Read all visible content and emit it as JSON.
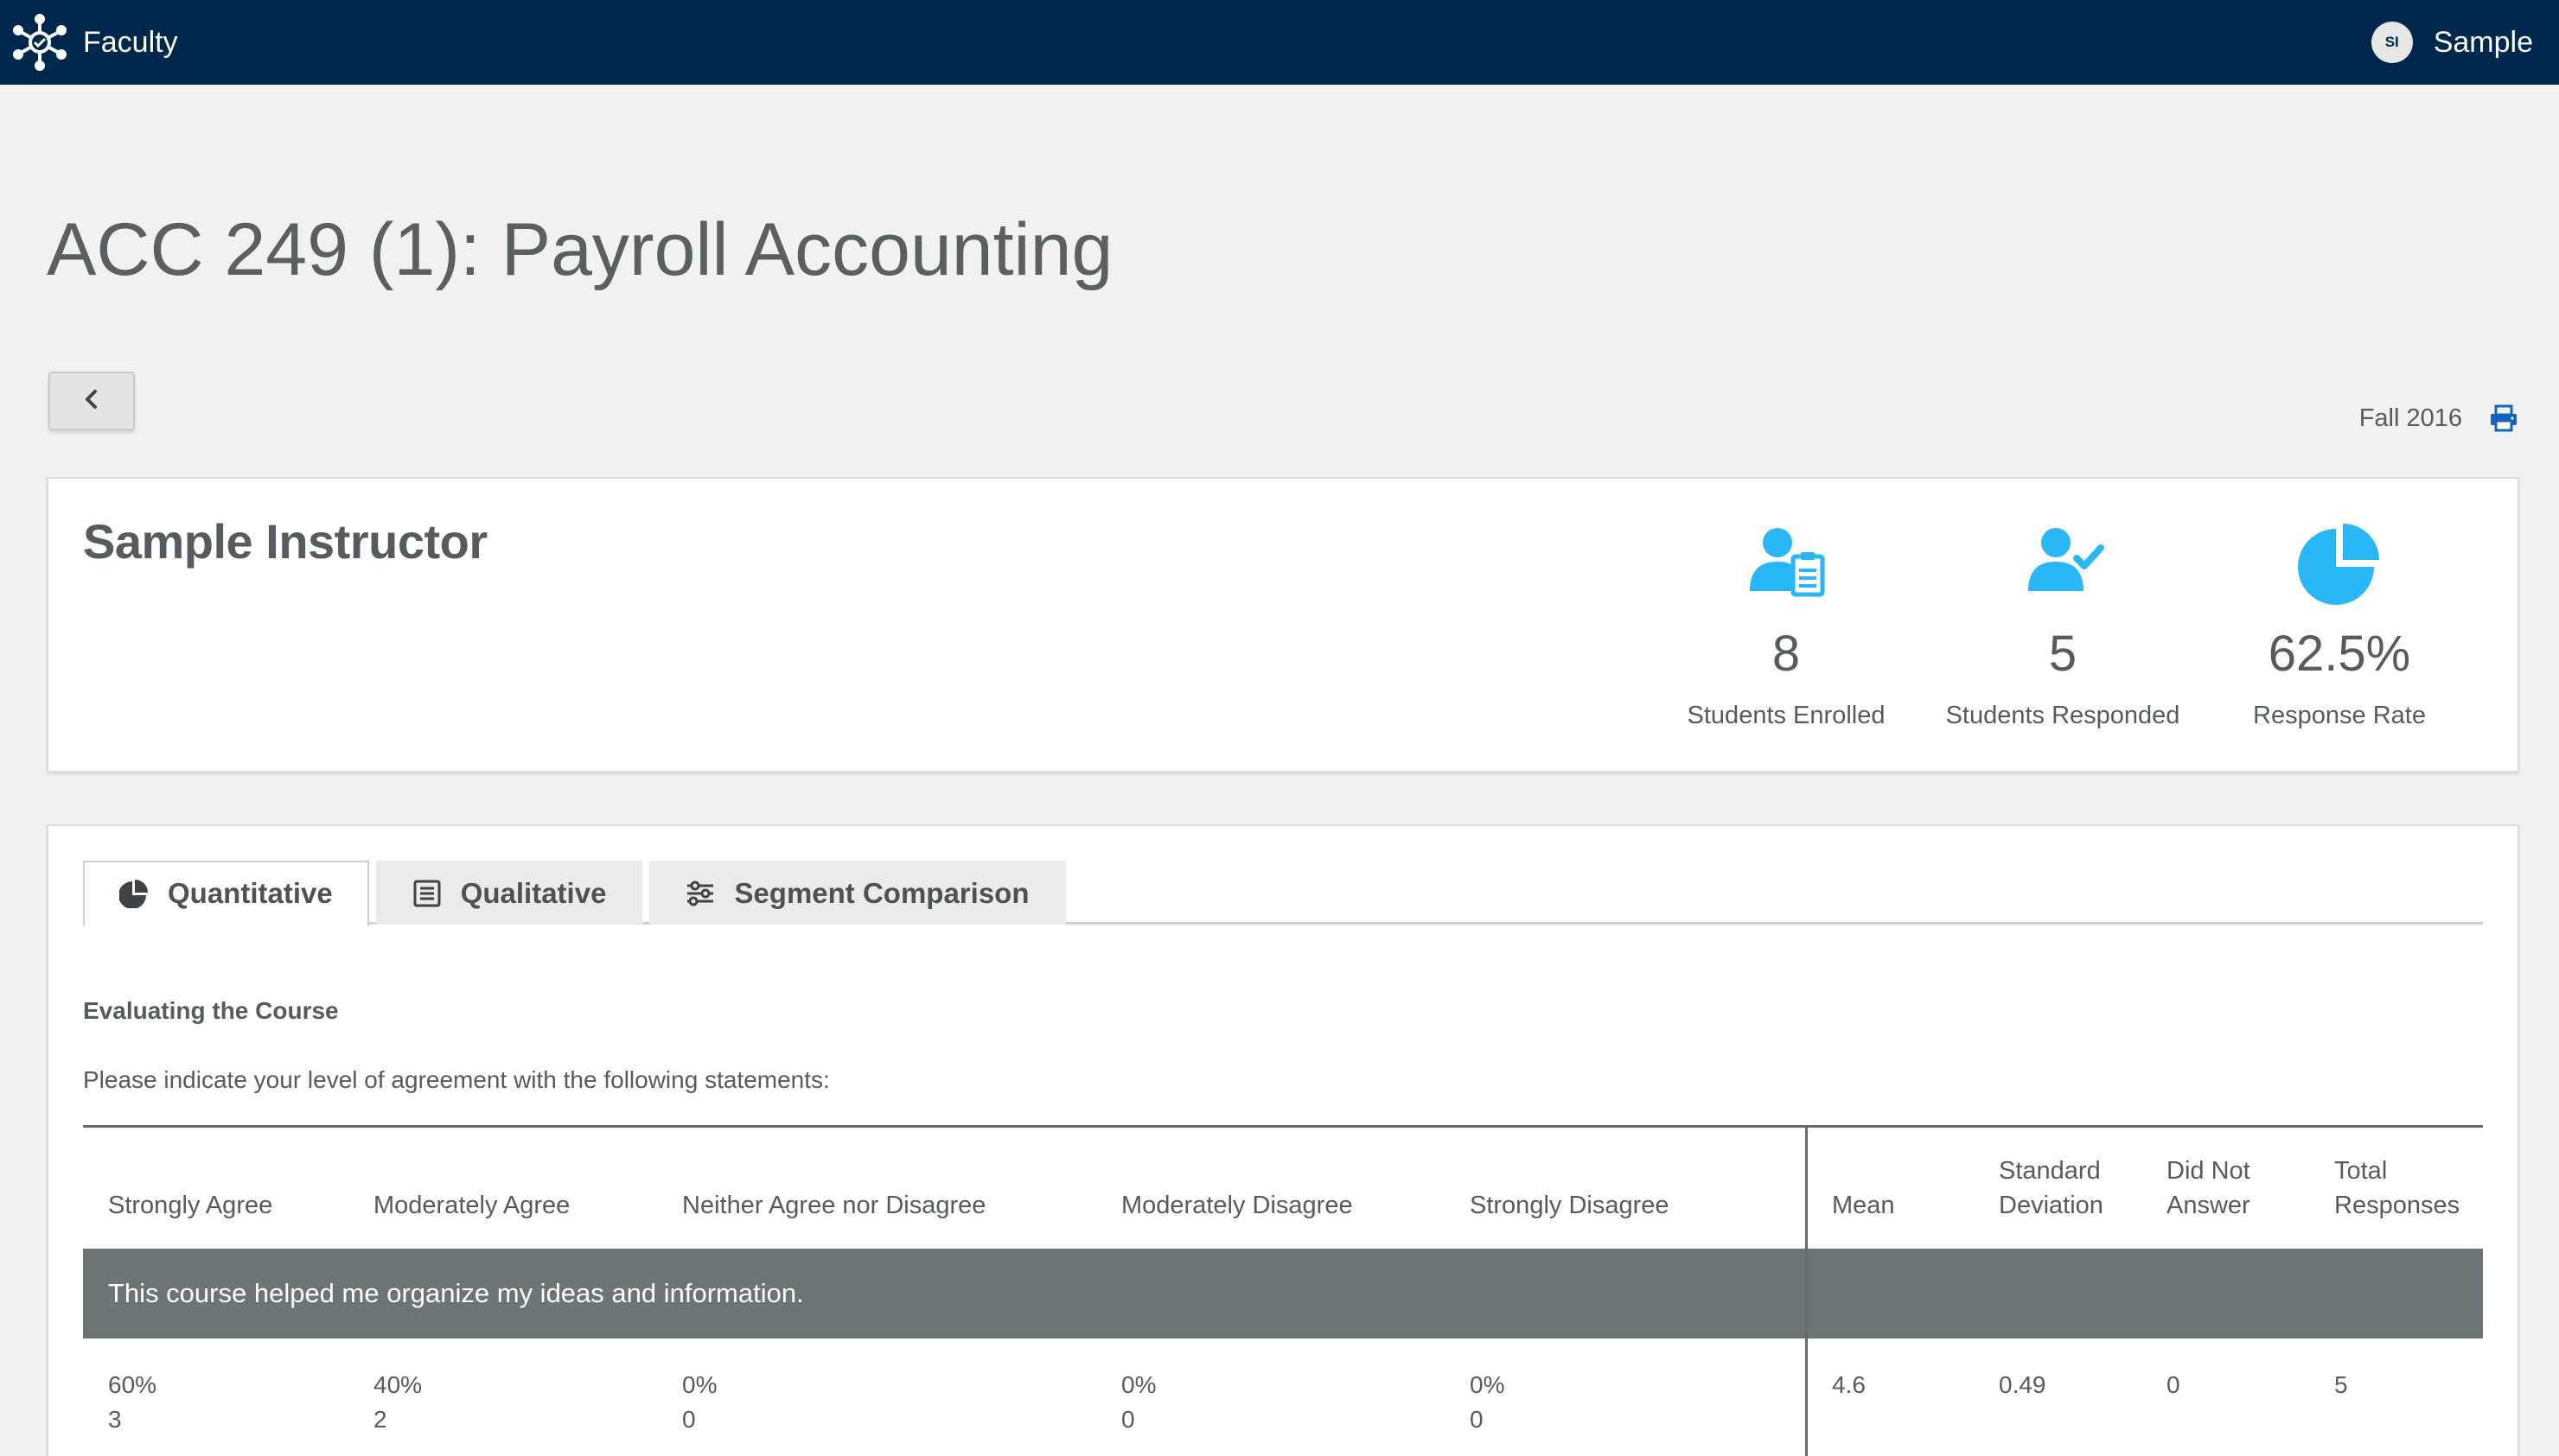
{
  "app": {
    "brand_name": "Faculty"
  },
  "user": {
    "initials": "SI",
    "name": "Sample"
  },
  "page": {
    "title": "ACC 249 (1): Payroll Accounting",
    "term": "Fall 2016"
  },
  "instructor": {
    "name": "Sample Instructor",
    "stats": [
      {
        "value": "8",
        "label": "Students Enrolled",
        "icon": "user-clipboard-icon"
      },
      {
        "value": "5",
        "label": "Students Responded",
        "icon": "user-check-icon"
      },
      {
        "value": "62.5%",
        "label": "Response Rate",
        "icon": "pie-chart-icon"
      }
    ]
  },
  "tabs": [
    {
      "label": "Quantitative",
      "icon": "pie-chart-icon",
      "active": true
    },
    {
      "label": "Qualitative",
      "icon": "document-list-icon",
      "active": false
    },
    {
      "label": "Segment Comparison",
      "icon": "sliders-icon",
      "active": false
    }
  ],
  "section": {
    "title": "Evaluating the Course",
    "description": "Please indicate your level of agreement with the following statements:"
  },
  "table": {
    "headers": {
      "strongly_agree": "Strongly Agree",
      "moderately_agree": "Moderately Agree",
      "neither": "Neither Agree nor Disagree",
      "moderately_disagree": "Moderately Disagree",
      "strongly_disagree": "Strongly Disagree",
      "mean": "Mean",
      "std_line1": "Standard",
      "std_line2": "Deviation",
      "dna_line1": "Did Not",
      "dna_line2": "Answer",
      "total_line1": "Total",
      "total_line2": "Responses"
    },
    "rows": [
      {
        "question": "This course helped me organize my ideas and information.",
        "strongly_agree": {
          "pct": "60%",
          "count": "3"
        },
        "moderately_agree": {
          "pct": "40%",
          "count": "2"
        },
        "neither": {
          "pct": "0%",
          "count": "0"
        },
        "moderately_disagree": {
          "pct": "0%",
          "count": "0"
        },
        "strongly_disagree": {
          "pct": "0%",
          "count": "0"
        },
        "mean": "4.6",
        "std": "0.49",
        "did_not_answer": "0",
        "total": "5"
      }
    ]
  },
  "colors": {
    "navbar": "#00274c",
    "accent": "#29b6f6",
    "question_bar": "#6d7477",
    "print_icon": "#1565c0"
  }
}
